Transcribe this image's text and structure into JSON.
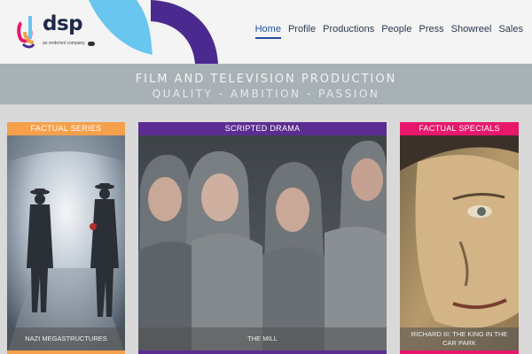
{
  "brand": {
    "name": "dsp",
    "tagline": "an endemol company"
  },
  "nav": {
    "items": [
      {
        "label": "Home",
        "active": true
      },
      {
        "label": "Profile",
        "active": false
      },
      {
        "label": "Productions",
        "active": false
      },
      {
        "label": "People",
        "active": false
      },
      {
        "label": "Press",
        "active": false
      },
      {
        "label": "Showreel",
        "active": false
      },
      {
        "label": "Sales",
        "active": false
      }
    ]
  },
  "banner": {
    "line1": "FILM AND TELEVISION PRODUCTION",
    "line2": "QUALITY  -  AMBITION  -  PASSION"
  },
  "cards": [
    {
      "category": "FACTUAL SERIES",
      "caption": "NAZI MEGASTRUCTURES",
      "color": "#f5a04a"
    },
    {
      "category": "SCRIPTED DRAMA",
      "caption": "THE MILL",
      "color": "#5b2d91"
    },
    {
      "category": "FACTUAL SPECIALS",
      "caption": "RICHARD III: THE KING IN THE CAR PARK",
      "color": "#e8176b"
    }
  ],
  "colors": {
    "nav_active": "#1f4f9a",
    "deco_blue": "#68c6ef",
    "deco_purple": "#4b2a8f"
  }
}
